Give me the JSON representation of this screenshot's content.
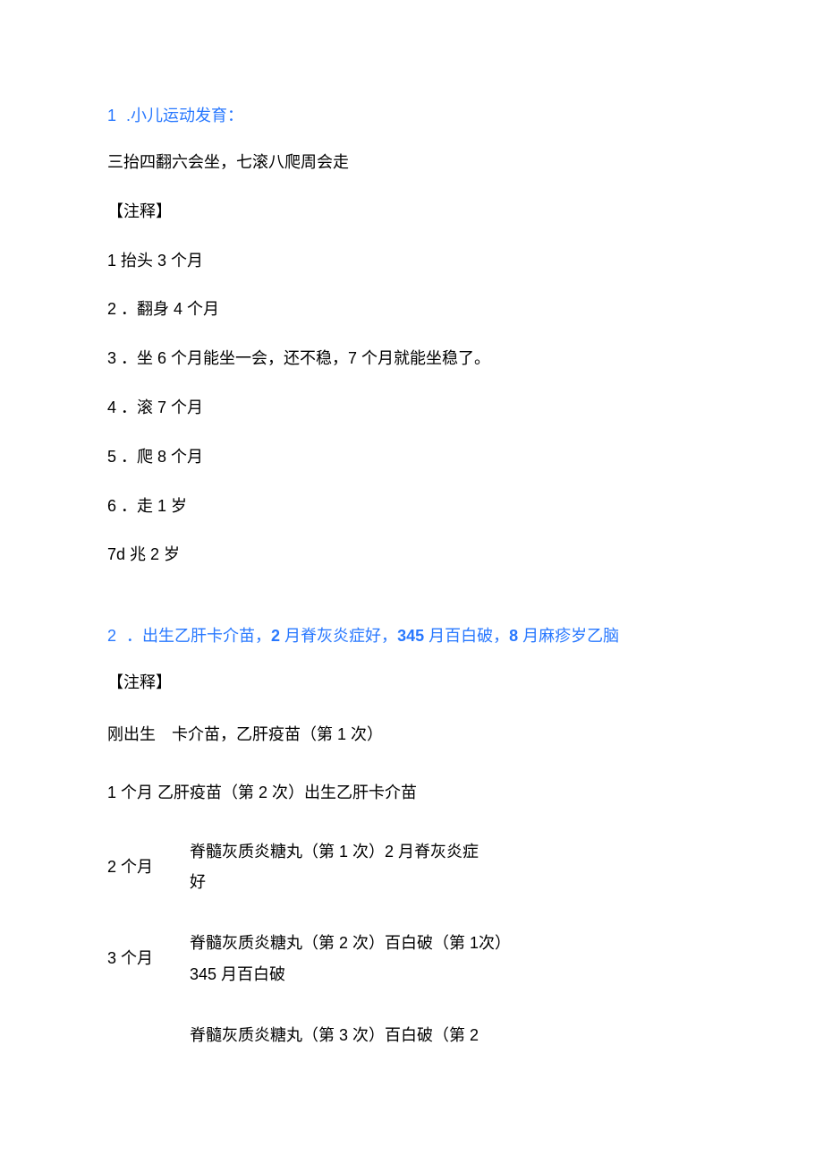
{
  "section1": {
    "heading_num": "1",
    "heading_text": ".小儿运动发育：",
    "p1": "三抬四翻六会坐，七滚八爬周会走",
    "p2": "【注释】",
    "p3": "1 抬头 3 个月",
    "p4": "2 ．翻身 4 个月",
    "p5": "3 ．坐 6 个月能坐一会，还不稳，7 个月就能坐稳了。",
    "p6": "4 ．滚 7 个月",
    "p7": "5 ．爬 8 个月",
    "p8": "6 ．走 1 岁",
    "p9": "7d 兆 2 岁"
  },
  "section2": {
    "heading_num": "2",
    "heading_text_a": "．出生乙肝卡介苗，",
    "heading_text_b": "2",
    "heading_text_c": " 月脊灰炎症好，",
    "heading_text_d": "345",
    "heading_text_e": " 月百白破，",
    "heading_text_f": "8",
    "heading_text_g": " 月麻疹岁乙脑",
    "p1": "【注释】",
    "rows": [
      {
        "left": "刚出生",
        "right": "卡介苗，乙肝疫苗（第 1 次）"
      }
    ],
    "p_plain": "1 个月 乙肝疫苗（第 2 次）出生乙肝卡介苗",
    "rows2": [
      {
        "left": "2 个月",
        "right": "脊髓灰质炎糖丸（第 1 次）2 月脊灰炎症好"
      },
      {
        "left": "3 个月",
        "right": "脊髓灰质炎糖丸（第 2 次）百白破（第 1次）345 月百白破"
      }
    ],
    "tail": "脊髓灰质炎糖丸（第 3 次）百白破（第 2"
  }
}
